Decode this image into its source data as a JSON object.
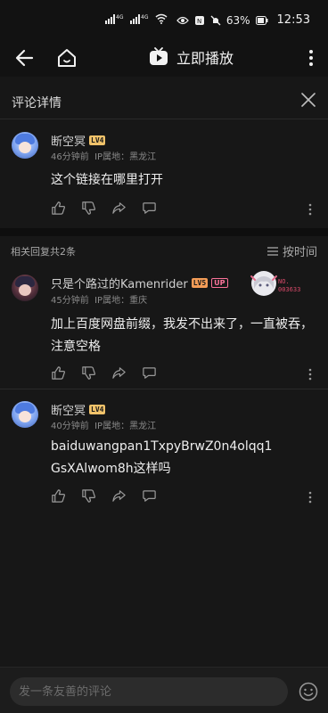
{
  "status": {
    "signal1": "⁴ᴳ",
    "signal2": "⁴ᴳ",
    "battery_percent": "63%",
    "time": "12:53"
  },
  "nav": {
    "play_label": "立即播放"
  },
  "panel": {
    "title": "评论详情"
  },
  "main_comment": {
    "user": "断空冥",
    "level": "LV4",
    "time": "46分钟前",
    "ip": "IP属地：黑龙江",
    "text": "这个链接在哪里打开"
  },
  "replies": {
    "count_label": "相关回复共2条",
    "sort_label": "按时间",
    "items": [
      {
        "user": "只是个路过的Kamenrider",
        "level": "LV5",
        "up": "UP",
        "time": "45分钟前",
        "ip": "IP属地：重庆",
        "text": "加上百度网盘前缀，我发不出来了，一直被吞，注意空格",
        "fan_no_label": "NO.",
        "fan_no": "003633"
      },
      {
        "user": "断空冥",
        "level": "LV4",
        "time": "40分钟前",
        "ip": "IP属地：黑龙江",
        "text": "baiduwangpan1TxpyBrwZ0n4olqq1GsXAlwom8h这样吗"
      }
    ]
  },
  "bottom": {
    "placeholder": "发一条友善的评论"
  },
  "colors": {
    "background": "#171717",
    "level4": "#f0c26a",
    "level5": "#f39c57",
    "up_pink": "#fb7299"
  }
}
